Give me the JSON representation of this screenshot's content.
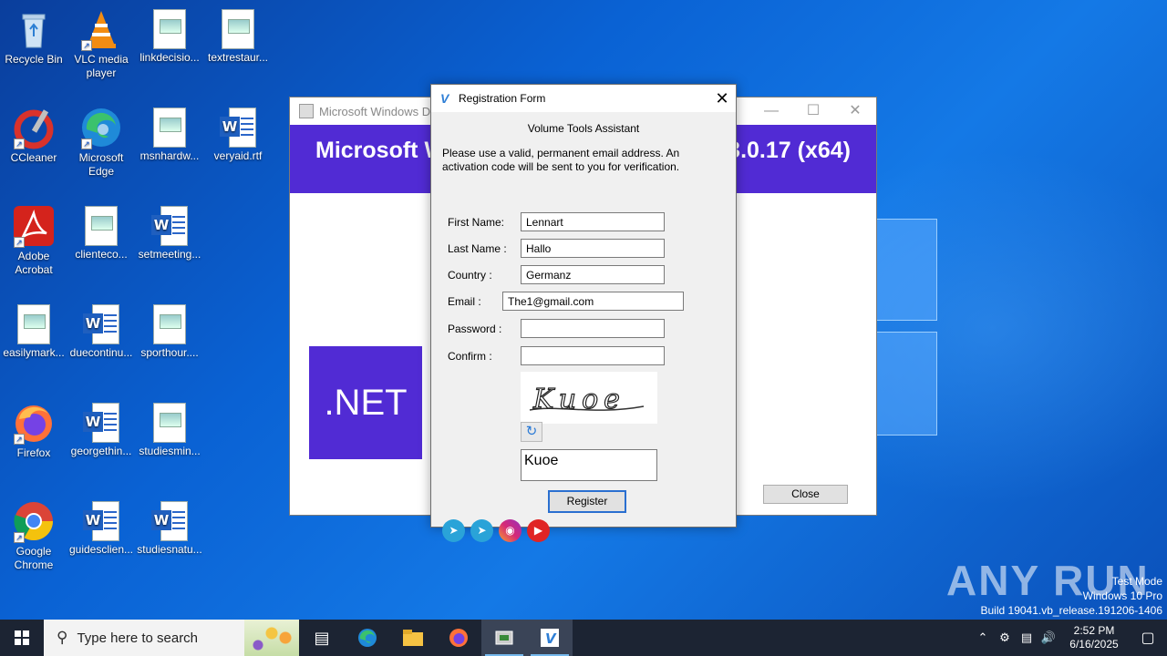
{
  "desktop": {
    "icons": [
      {
        "label": "Recycle Bin"
      },
      {
        "label": "VLC media player"
      },
      {
        "label": "linkdecisio..."
      },
      {
        "label": "textrestaur..."
      },
      {
        "label": "CCleaner"
      },
      {
        "label": "Microsoft Edge"
      },
      {
        "label": "msnhardw..."
      },
      {
        "label": "veryaid.rtf"
      },
      {
        "label": "Adobe Acrobat"
      },
      {
        "label": "clienteco..."
      },
      {
        "label": "setmeeting..."
      },
      {
        "label": "easilymark..."
      },
      {
        "label": "duecontinu..."
      },
      {
        "label": "sporthour...."
      },
      {
        "label": "Firefox"
      },
      {
        "label": "georgethin..."
      },
      {
        "label": "studiesmin..."
      },
      {
        "label": "Google Chrome"
      },
      {
        "label": "guidesclien..."
      },
      {
        "label": "studiesnatu..."
      }
    ]
  },
  "installer": {
    "title": "Microsoft Windows Des",
    "banner_left": "Microsoft W",
    "banner_right": "3.0.17 (x64)",
    "net_logo": ".NET",
    "close_label": "Close"
  },
  "dialog": {
    "title": "Registration Form",
    "subtitle": "Volume Tools Assistant",
    "note": "Please use a valid, permanent email address. An activation code will be sent to you for verification.",
    "fields": {
      "first_name": {
        "label": "First Name:",
        "value": "Lennart"
      },
      "last_name": {
        "label": "Last Name :",
        "value": "Hallo"
      },
      "country": {
        "label": "Country :",
        "value": "Germanz"
      },
      "email": {
        "label": "Email :",
        "value": "The1@gmail.com"
      },
      "password": {
        "label": "Password :",
        "value": ""
      },
      "confirm": {
        "label": "Confirm :",
        "value": ""
      }
    },
    "captcha_text": "Kuoe",
    "captcha_input": "Kuoe",
    "register_label": "Register"
  },
  "watermark": {
    "brand": "ANY RUN",
    "line1": "Test Mode",
    "line2": "Windows 10 Pro",
    "line3": "Build 19041.vb_release.191206-1406"
  },
  "taskbar": {
    "search_placeholder": "Type here to search",
    "time": "2:52 PM",
    "date": "6/16/2025"
  }
}
